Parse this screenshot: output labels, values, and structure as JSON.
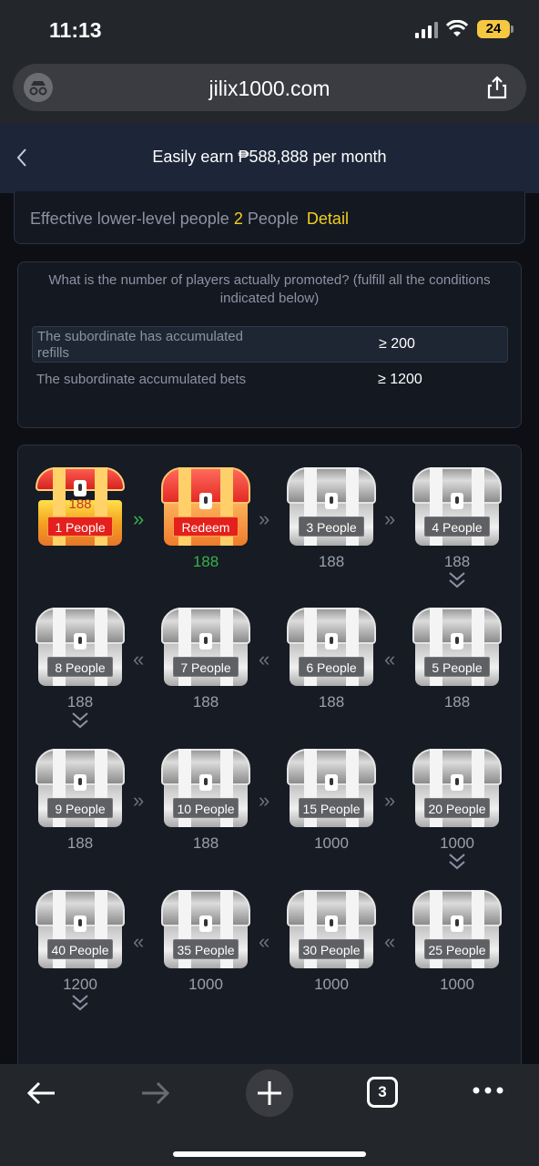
{
  "status_bar": {
    "time": "11:13",
    "battery": "24"
  },
  "browser": {
    "url": "jilix1000.com",
    "tab_count": "3"
  },
  "header": {
    "title": "Easily earn ₱588,888 per month"
  },
  "effective": {
    "prefix": "Effective lower-level people",
    "count": "2",
    "unit": "People",
    "detail": "Detail"
  },
  "conditions": {
    "question": "What is the number of players actually promoted? (fulfill all the conditions indicated below)",
    "rows": [
      {
        "label": "The subordinate has accumulated refills",
        "value": "≥ 200"
      },
      {
        "label": "The subordinate accumulated bets",
        "value": "≥ 1200"
      }
    ]
  },
  "chests": [
    {
      "label": "1 People",
      "amount": "",
      "inner": "188"
    },
    {
      "label": "Redeem",
      "amount": "188"
    },
    {
      "label": "3 People",
      "amount": "188"
    },
    {
      "label": "4 People",
      "amount": "188"
    },
    {
      "label": "8 People",
      "amount": "188"
    },
    {
      "label": "7 People",
      "amount": "188"
    },
    {
      "label": "6 People",
      "amount": "188"
    },
    {
      "label": "5 People",
      "amount": "188"
    },
    {
      "label": "9 People",
      "amount": "188"
    },
    {
      "label": "10 People",
      "amount": "188"
    },
    {
      "label": "15 People",
      "amount": "1000"
    },
    {
      "label": "20 People",
      "amount": "1000"
    },
    {
      "label": "40 People",
      "amount": "1200"
    },
    {
      "label": "35 People",
      "amount": "1000"
    },
    {
      "label": "30 People",
      "amount": "1000"
    },
    {
      "label": "25 People",
      "amount": "1000"
    }
  ],
  "colors": {
    "accent_yellow": "#f2d01e",
    "claimed_green": "#35b24a",
    "redeem_red": "#e3201c"
  }
}
